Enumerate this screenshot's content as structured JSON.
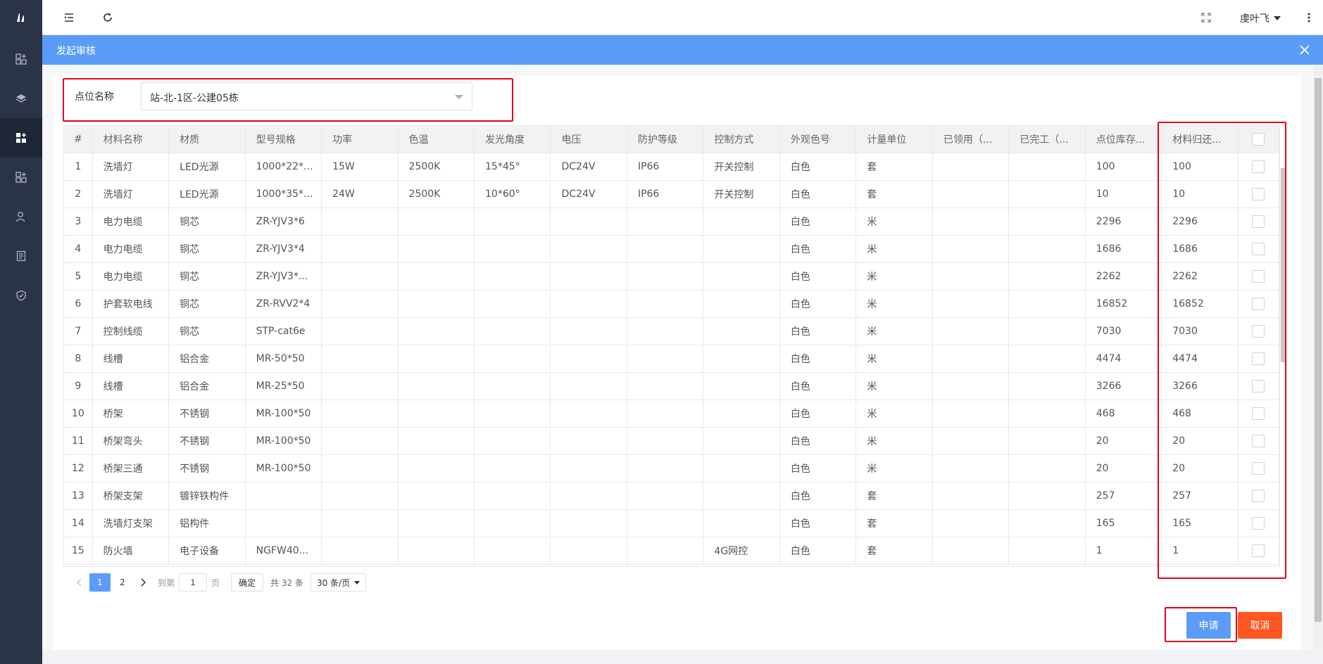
{
  "topbar": {
    "user": "虔叶飞",
    "icons": [
      "menu-fold-icon",
      "refresh-icon",
      "fullscreen-icon",
      "more-vertical-icon"
    ]
  },
  "sidebar": {
    "icons": [
      "logo",
      "apps-icon",
      "layers-icon",
      "apps-icon",
      "apps-icon",
      "user-icon",
      "document-icon",
      "shield-icon"
    ]
  },
  "modal": {
    "title": "发起审核"
  },
  "form": {
    "location_label": "点位名称",
    "location_value": "站-北-1区-公建05栋"
  },
  "table": {
    "columns": [
      "#",
      "材料名称",
      "材质",
      "型号规格",
      "功率",
      "色温",
      "发光角度",
      "电压",
      "防护等级",
      "控制方式",
      "外观色号",
      "计量单位",
      "已领用（...",
      "已完工（...",
      "点位库存...",
      "材料归还..."
    ],
    "rows": [
      [
        "1",
        "洗墙灯",
        "LED光源",
        "1000*22*...",
        "15W",
        "2500K",
        "15*45°",
        "DC24V",
        "IP66",
        "开关控制",
        "白色",
        "套",
        "",
        "",
        "100",
        "100"
      ],
      [
        "2",
        "洗墙灯",
        "LED光源",
        "1000*35*...",
        "24W",
        "2500K",
        "10*60°",
        "DC24V",
        "IP66",
        "开关控制",
        "白色",
        "套",
        "",
        "",
        "10",
        "10"
      ],
      [
        "3",
        "电力电缆",
        "铜芯",
        "ZR-YJV3*6",
        "",
        "",
        "",
        "",
        "",
        "",
        "白色",
        "米",
        "",
        "",
        "2296",
        "2296"
      ],
      [
        "4",
        "电力电缆",
        "铜芯",
        "ZR-YJV3*4",
        "",
        "",
        "",
        "",
        "",
        "",
        "白色",
        "米",
        "",
        "",
        "1686",
        "1686"
      ],
      [
        "5",
        "电力电缆",
        "铜芯",
        "ZR-YJV3*...",
        "",
        "",
        "",
        "",
        "",
        "",
        "白色",
        "米",
        "",
        "",
        "2262",
        "2262"
      ],
      [
        "6",
        "护套软电线",
        "铜芯",
        "ZR-RVV2*4",
        "",
        "",
        "",
        "",
        "",
        "",
        "白色",
        "米",
        "",
        "",
        "16852",
        "16852"
      ],
      [
        "7",
        "控制线缆",
        "铜芯",
        "STP-cat6e",
        "",
        "",
        "",
        "",
        "",
        "",
        "白色",
        "米",
        "",
        "",
        "7030",
        "7030"
      ],
      [
        "8",
        "线槽",
        "铝合金",
        "MR-50*50",
        "",
        "",
        "",
        "",
        "",
        "",
        "白色",
        "米",
        "",
        "",
        "4474",
        "4474"
      ],
      [
        "9",
        "线槽",
        "铝合金",
        "MR-25*50",
        "",
        "",
        "",
        "",
        "",
        "",
        "白色",
        "米",
        "",
        "",
        "3266",
        "3266"
      ],
      [
        "10",
        "桥架",
        "不锈钢",
        "MR-100*50",
        "",
        "",
        "",
        "",
        "",
        "",
        "白色",
        "米",
        "",
        "",
        "468",
        "468"
      ],
      [
        "11",
        "桥架弯头",
        "不锈钢",
        "MR-100*50",
        "",
        "",
        "",
        "",
        "",
        "",
        "白色",
        "米",
        "",
        "",
        "20",
        "20"
      ],
      [
        "12",
        "桥架三通",
        "不锈钢",
        "MR-100*50",
        "",
        "",
        "",
        "",
        "",
        "",
        "白色",
        "米",
        "",
        "",
        "20",
        "20"
      ],
      [
        "13",
        "桥架支架",
        "镀锌铁构件",
        "",
        "",
        "",
        "",
        "",
        "",
        "",
        "白色",
        "套",
        "",
        "",
        "257",
        "257"
      ],
      [
        "14",
        "洗墙灯支架",
        "铝构件",
        "",
        "",
        "",
        "",
        "",
        "",
        "",
        "白色",
        "套",
        "",
        "",
        "165",
        "165"
      ],
      [
        "15",
        "防火墙",
        "电子设备",
        "NGFW40...",
        "",
        "",
        "",
        "",
        "",
        "4G网控",
        "白色",
        "套",
        "",
        "",
        "1",
        "1"
      ]
    ]
  },
  "pager": {
    "pages": [
      "1",
      "2"
    ],
    "current": "1",
    "goto_prefix": "到第",
    "goto_value": "1",
    "goto_suffix": "页",
    "confirm": "确定",
    "total": "共 32 条",
    "page_size": "30 条/页"
  },
  "actions": {
    "apply": "申请",
    "cancel": "取消"
  }
}
